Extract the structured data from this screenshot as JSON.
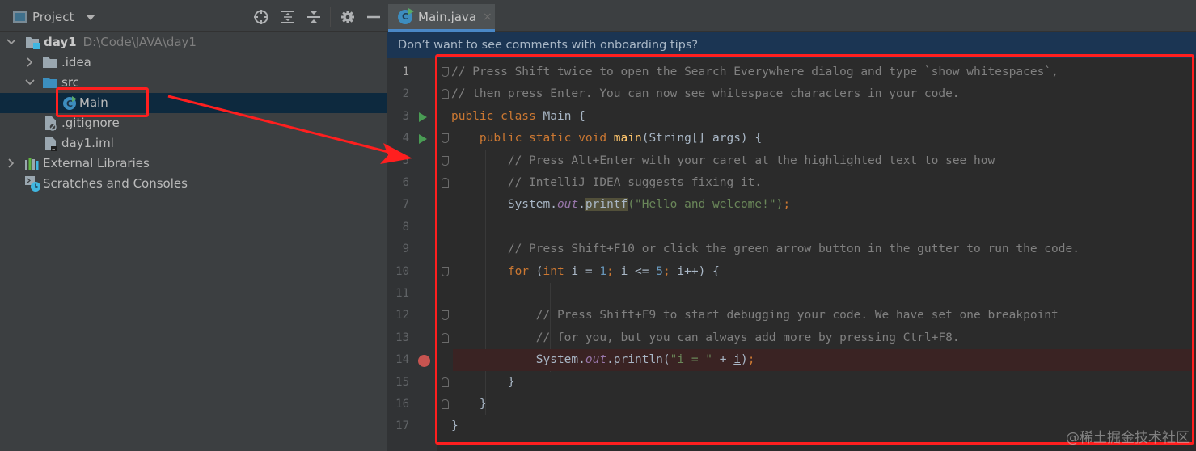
{
  "project_panel": {
    "title": "Project",
    "header_icons": [
      "locate-icon",
      "expand-all-icon",
      "collapse-all-icon",
      "gear-icon",
      "hide-icon"
    ],
    "tree": [
      {
        "label": "day1",
        "path": "D:\\Code\\JAVA\\day1",
        "icon": "module-folder-icon",
        "expanded": true
      },
      {
        "label": ".idea",
        "icon": "folder-icon",
        "expanded": false
      },
      {
        "label": "src",
        "icon": "source-folder-icon",
        "expanded": true
      },
      {
        "label": "Main",
        "icon": "java-class-icon",
        "selected": true
      },
      {
        "label": ".gitignore",
        "icon": "ignored-file-icon"
      },
      {
        "label": "day1.iml",
        "icon": "iml-file-icon"
      },
      {
        "label": "External Libraries",
        "icon": "libraries-icon",
        "expanded": false
      },
      {
        "label": "Scratches and Consoles",
        "icon": "scratches-icon"
      }
    ]
  },
  "editor": {
    "tab": {
      "label": "Main.java",
      "close": "×"
    },
    "onboarding_banner": "Don’t want to see comments with onboarding tips?",
    "current_line": 1,
    "breakpoint_line": 14,
    "run_lines": [
      3,
      4
    ],
    "lines": [
      [
        {
          "t": "comment",
          "v": "// Press Shift twice to open the Search Everywhere dialog and type `show whitespaces`,"
        }
      ],
      [
        {
          "t": "comment",
          "v": "// then press Enter. You can now see whitespace characters in your code."
        }
      ],
      [
        {
          "t": "kw",
          "v": "public class "
        },
        {
          "t": "plain",
          "v": "Main {"
        }
      ],
      [
        {
          "t": "plain",
          "v": "    "
        },
        {
          "t": "kw",
          "v": "public static void "
        },
        {
          "t": "fn",
          "v": "main"
        },
        {
          "t": "plain",
          "v": "(String[] args) {"
        }
      ],
      [
        {
          "t": "plain",
          "v": "        "
        },
        {
          "t": "comment",
          "v": "// Press Alt+Enter with your caret at the highlighted text to see how"
        }
      ],
      [
        {
          "t": "plain",
          "v": "        "
        },
        {
          "t": "comment",
          "v": "// IntelliJ IDEA suggests fixing it."
        }
      ],
      [
        {
          "t": "plain",
          "v": "        System."
        },
        {
          "t": "field",
          "v": "out"
        },
        {
          "t": "plain",
          "v": "."
        },
        {
          "t": "hl",
          "v": "printf"
        },
        {
          "t": "str",
          "v": "(\"Hello and welcome!\")"
        },
        {
          "t": "kw",
          "v": ";"
        }
      ],
      [
        {
          "t": "plain",
          "v": ""
        }
      ],
      [
        {
          "t": "plain",
          "v": "        "
        },
        {
          "t": "comment",
          "v": "// Press Shift+F10 or click the green arrow button in the gutter to run the code."
        }
      ],
      [
        {
          "t": "plain",
          "v": "        "
        },
        {
          "t": "kw",
          "v": "for "
        },
        {
          "t": "plain",
          "v": "("
        },
        {
          "t": "kw",
          "v": "int "
        },
        {
          "t": "var",
          "v": "i"
        },
        {
          "t": "plain",
          "v": " = "
        },
        {
          "t": "num",
          "v": "1"
        },
        {
          "t": "kw",
          "v": "; "
        },
        {
          "t": "var",
          "v": "i"
        },
        {
          "t": "plain",
          "v": " <= "
        },
        {
          "t": "num",
          "v": "5"
        },
        {
          "t": "kw",
          "v": "; "
        },
        {
          "t": "var",
          "v": "i"
        },
        {
          "t": "plain",
          "v": "++) {"
        }
      ],
      [
        {
          "t": "plain",
          "v": ""
        }
      ],
      [
        {
          "t": "plain",
          "v": "            "
        },
        {
          "t": "comment",
          "v": "// Press Shift+F9 to start debugging your code. We have set one breakpoint"
        }
      ],
      [
        {
          "t": "plain",
          "v": "            "
        },
        {
          "t": "comment",
          "v": "// for you, but you can always add more by pressing Ctrl+F8."
        }
      ],
      [
        {
          "t": "plain",
          "v": "            System."
        },
        {
          "t": "field",
          "v": "out"
        },
        {
          "t": "plain",
          "v": ".println("
        },
        {
          "t": "str",
          "v": "\"i = \""
        },
        {
          "t": "plain",
          "v": " + "
        },
        {
          "t": "var",
          "v": "i"
        },
        {
          "t": "plain",
          "v": ")"
        },
        {
          "t": "kw",
          "v": ";"
        }
      ],
      [
        {
          "t": "plain",
          "v": "        }"
        }
      ],
      [
        {
          "t": "plain",
          "v": "    }"
        }
      ],
      [
        {
          "t": "plain",
          "v": "}"
        }
      ]
    ]
  },
  "annotation": {
    "color": "#ff1f1f",
    "watermark": "@稀土掘金技术社区"
  }
}
